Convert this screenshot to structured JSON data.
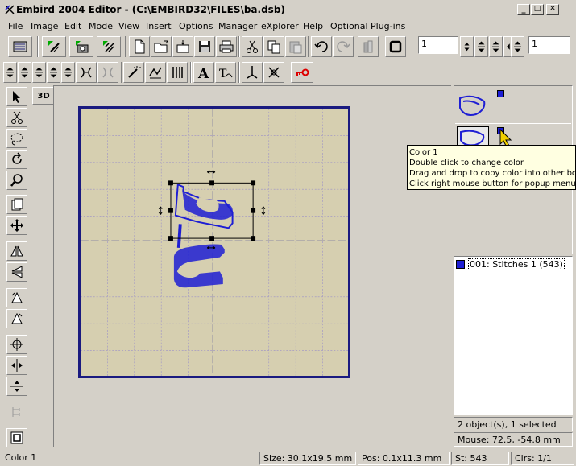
{
  "window": {
    "title": "Embird 2004 Editor - (C:\\EMBIRD32\\FILES\\ba.dsb)",
    "minimize": "_",
    "maximize": "□",
    "close": "✕"
  },
  "menu": [
    "File",
    "Image",
    "Edit",
    "Mode",
    "View",
    "Insert",
    "Options",
    "Manager",
    "eXplorer",
    "Help",
    "Optional Plug-ins"
  ],
  "toolbar": {
    "spin_value_1": "1",
    "spin_value_2": "1"
  },
  "left_tools": {
    "3d_label": "3D"
  },
  "colors": {
    "accent": "#1e1ed4",
    "hoop_fill": "#d6cfb0",
    "hoop_border": "#1a1a80"
  },
  "tooltip": {
    "line1": "Color 1",
    "line2": "Double click to change color",
    "line3": "Drag and drop to copy color into other box",
    "line4": "Click right mouse button for popup menu"
  },
  "objects": {
    "item1": "001:  Stitches 1 (543)"
  },
  "info": {
    "selection": "2 object(s), 1 selected",
    "mouse": "Mouse: 72.5, -54.8 mm"
  },
  "status": {
    "color": "Color 1",
    "size": "Size: 30.1x19.5 mm",
    "pos": "Pos: 0.1x11.3 mm",
    "stitches": "St: 543",
    "clrs": "Clrs: 1/1"
  }
}
